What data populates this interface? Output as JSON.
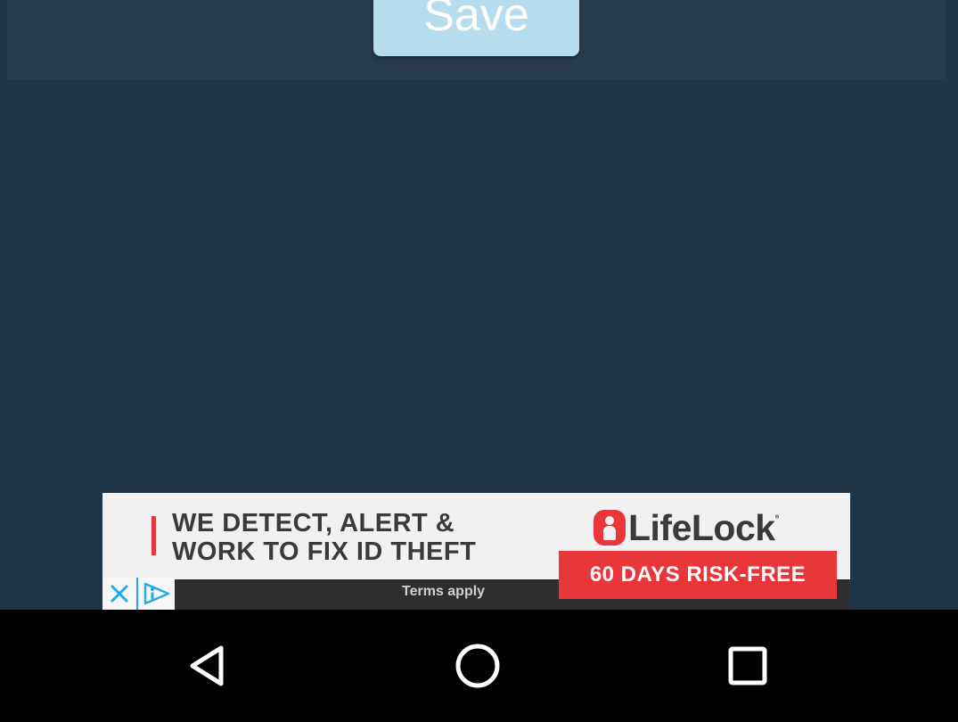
{
  "toolbar": {
    "save_label": "Save"
  },
  "ad": {
    "headline_line1": "WE DETECT, ALERT &",
    "headline_line2": "WORK TO FIX ID THEFT",
    "brand": "LifeLock",
    "brand_mark": "°",
    "cta": "60 DAYS RISK-FREE",
    "terms": "Terms apply",
    "close_icon": "close-icon",
    "adchoices_icon": "adchoices-icon",
    "accent_color": "#e8363b"
  },
  "nav": {
    "back_icon": "back-triangle-icon",
    "home_icon": "home-circle-icon",
    "recents_icon": "recents-square-icon"
  },
  "colors": {
    "background": "#203447",
    "panel": "#283b4f",
    "save_button": "#b5dcef",
    "nav_bar": "#000000"
  }
}
